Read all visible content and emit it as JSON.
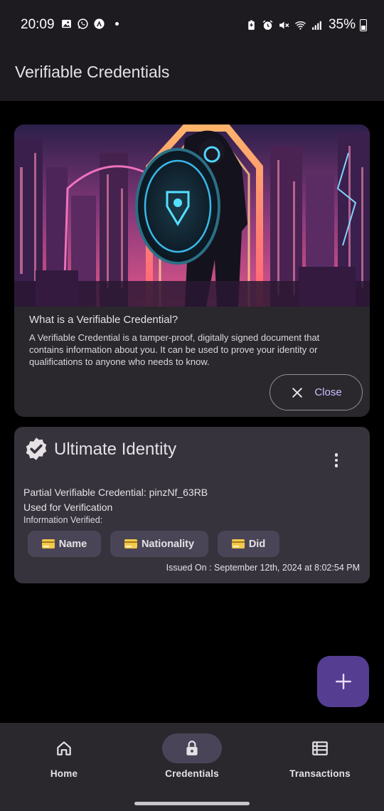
{
  "status_bar": {
    "time": "20:09",
    "battery": "35%",
    "left_icons": [
      "gallery-icon",
      "whatsapp-icon",
      "app-icon"
    ],
    "right_icons": [
      "battery-saver-icon",
      "alarm-icon",
      "mute-icon",
      "wifi-icon",
      "signal-icon",
      "battery-icon"
    ]
  },
  "app_bar": {
    "title": "Verifiable Credentials"
  },
  "info_card": {
    "title": "What is a Verifiable Credential?",
    "body": "A Verifiable Credential is a tamper-proof, digitally signed document that contains information about you. It can be used to prove your identity or qualifications to anyone who needs to know.",
    "close_label": "Close"
  },
  "credential": {
    "title": "Ultimate Identity",
    "line1": "Partial Verifiable Credential: pinzNf_63RB",
    "line2": "Used for Verification",
    "line3": "Information Verified:",
    "chips": [
      "Name",
      "Nationality",
      "Did"
    ],
    "issued": "Issued On : September 12th, 2024 at 8:02:54 PM"
  },
  "bottom_nav": {
    "items": [
      {
        "label": "Home",
        "icon": "home-icon",
        "active": false
      },
      {
        "label": "Credentials",
        "icon": "lock-icon",
        "active": true
      },
      {
        "label": "Transactions",
        "icon": "list-icon",
        "active": false
      }
    ]
  },
  "colors": {
    "background": "#000000",
    "surface": "#1d1b20",
    "card": "#2a282d",
    "credential_card": "#37333d",
    "accent": "#cfbcff",
    "fab": "#553e91"
  }
}
